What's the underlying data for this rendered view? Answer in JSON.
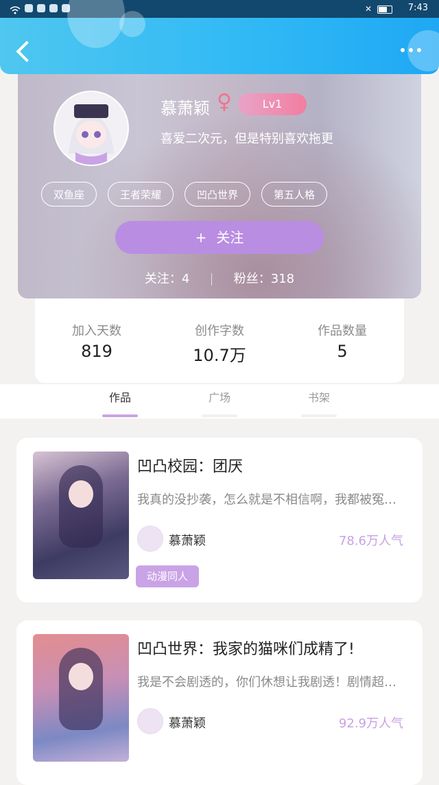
{
  "status_bar": {
    "time": "7:43"
  },
  "profile": {
    "username": "慕萧颖",
    "gender_symbol": "♀",
    "level": "Lv1",
    "signature": "喜爱二次元，但是特别喜欢拖更",
    "tags": [
      "双鱼座",
      "王者荣耀",
      "凹凸世界",
      "第五人格"
    ],
    "follow_label": "关注",
    "follow_plus": "+",
    "following": "关注：4",
    "fans": "粉丝：318"
  },
  "stats": [
    {
      "label": "加入天数",
      "value": "819"
    },
    {
      "label": "创作字数",
      "value": "10.7万"
    },
    {
      "label": "作品数量",
      "value": "5"
    }
  ],
  "tabs": [
    {
      "label": "作品",
      "active": true
    },
    {
      "label": "广场",
      "active": false
    },
    {
      "label": "书架",
      "active": false
    }
  ],
  "works": [
    {
      "title": "凹凸校园：团厌",
      "desc": "我真的没抄袭，怎么就是不相信啊，我都被冤枉得要哭了",
      "author": "慕萧颖",
      "popularity": "78.6万人气",
      "tag": "动漫同人"
    },
    {
      "title": "凹凸世界：我家的猫咪们成精了!",
      "desc": "我是不会剧透的，你们休想让我剧透！剧情超级精彩",
      "author": "慕萧颖",
      "popularity": "92.9万人气",
      "tag": ""
    }
  ]
}
